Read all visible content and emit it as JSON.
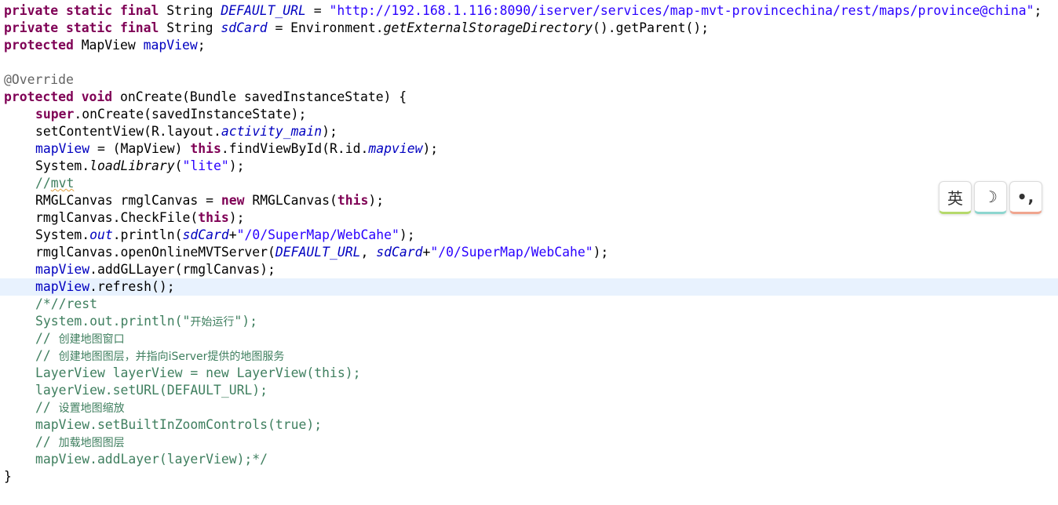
{
  "code": {
    "line01": {
      "kw1": "private",
      "kw2": "static",
      "kw3": "final",
      "type": "String",
      "name": "DEFAULT_URL",
      "op": " = ",
      "value": "\"http://192.168.1.116:8090/iserver/services/map-mvt-provincechina/rest/maps/province@china\"",
      "end": ";"
    },
    "line02": {
      "kw1": "private",
      "kw2": "static",
      "kw3": "final",
      "type": "String",
      "name": "sdCard",
      "op": " = Environment.",
      "call": "getExternalStorageDirectory",
      "end": "().getParent();"
    },
    "line03": {
      "kw": "protected",
      "type": "MapView",
      "name": "mapView",
      "end": ";"
    },
    "line05": {
      "annotation": "@Override"
    },
    "line06": {
      "kw1": "protected",
      "kw2": "void",
      "rest": "onCreate(Bundle savedInstanceState) {"
    },
    "line07": {
      "kw": "super",
      "rest": ".onCreate(savedInstanceState);"
    },
    "line08": {
      "pre": "setContentView(R.layout.",
      "field": "activity_main",
      "post": ");"
    },
    "line09": {
      "field": "mapView",
      "mid": " = (MapView) ",
      "kw": "this",
      "mid2": ".findViewById(R.id.",
      "field2": "mapview",
      "post": ");"
    },
    "line10": {
      "pre": "System.",
      "call": "loadLibrary",
      "open": "(",
      "str": "\"lite\"",
      "post": ");"
    },
    "line11": {
      "slashes": "//",
      "word": "mvt"
    },
    "line12": {
      "pre": "RMGLCanvas rmglCanvas = ",
      "kw": "new",
      "mid": " RMGLCanvas(",
      "kw2": "this",
      "post": ");"
    },
    "line13": {
      "pre": "rmglCanvas.CheckFile(",
      "kw": "this",
      "post": ");"
    },
    "line14": {
      "pre": "System.",
      "field": "out",
      "mid": ".println(",
      "field2": "sdCard",
      "plus": "+",
      "str": "\"/0/SuperMap/WebCahe\"",
      "post": ");"
    },
    "line15": {
      "pre": "rmglCanvas.openOnlineMVTServer(",
      "field": "DEFAULT_URL",
      "comma": ", ",
      "field2": "sdCard",
      "plus": "+",
      "str": "\"/0/SuperMap/WebCahe\"",
      "post": ");"
    },
    "line16": {
      "field": "mapView",
      "post": ".addGLLayer(rmglCanvas);"
    },
    "line17": {
      "field": "mapView",
      "post": ".refresh();"
    },
    "line18": "/*//rest",
    "line19a": "System.out.println(\"",
    "line19b": "开始运行",
    "line19c": "\");",
    "line20a": "// ",
    "line20b": "创建地图窗口",
    "line21a": "// ",
    "line21b": "创建地图图层，并指向",
    "line21c": "iServer",
    "line21d": "提供的地图服务",
    "line22": "LayerView layerView = new LayerView(this);",
    "line23": "layerView.setURL(DEFAULT_URL);",
    "line24a": "// ",
    "line24b": "设置地图缩放",
    "line25": "mapView.setBuiltInZoomControls(true);",
    "line26a": "// ",
    "line26b": "加载地图图层",
    "line27": "mapView.addLayer(layerView);*/",
    "line28": "}"
  },
  "ime_toolbar": {
    "lang_label": "英",
    "moon_glyph": "☽",
    "punct_label": "•,"
  },
  "colors": {
    "keyword": "#7f0055",
    "field": "#0000c0",
    "string": "#2a00ff",
    "comment": "#3f7f5f",
    "annotation": "#646464",
    "current_line": "#e8f2fe"
  }
}
